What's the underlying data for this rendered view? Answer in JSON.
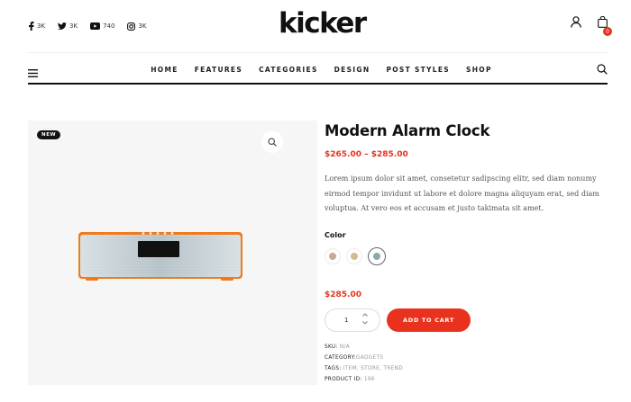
{
  "header": {
    "social": [
      {
        "icon": "facebook-icon",
        "count": "3K"
      },
      {
        "icon": "twitter-icon",
        "count": "3K"
      },
      {
        "icon": "youtube-icon",
        "count": "740"
      },
      {
        "icon": "instagram-icon",
        "count": "3K"
      }
    ],
    "logo": "kicker",
    "cart_count": "0"
  },
  "nav": {
    "items": [
      "HOME",
      "FEATURES",
      "CATEGORIES",
      "DESIGN",
      "POST STYLES",
      "SHOP"
    ]
  },
  "product": {
    "badge": "NEW",
    "title": "Modern Alarm Clock",
    "price_range": "$265.00 – $285.00",
    "description": "Lorem ipsum dolor sit amet, consetetur sadipscing elitr, sed diam nonumy eirmod tempor invidunt ut labore et dolore magna aliquyam erat, sed diam voluptua. At vero eos et accusam et justo takimata sit amet.",
    "color_label": "Color",
    "colors": [
      {
        "hex": "#c8a998"
      },
      {
        "hex": "#d1bc8e"
      },
      {
        "hex": "#8aa9ac",
        "selected": true
      }
    ],
    "price": "$285.00",
    "quantity": "1",
    "add_to_cart_label": "ADD TO CART",
    "meta": {
      "sku_label": "SKU:",
      "sku": "N/A",
      "category_label": "CATEGORY:",
      "category": "GADGETS",
      "tags_label": "TAGS:",
      "tags": "ITEM, STORE, TREND",
      "product_id_label": "PRODUCT ID:",
      "product_id": "196"
    }
  },
  "colors": {
    "accent": "#e8321d",
    "text": "#111111"
  }
}
